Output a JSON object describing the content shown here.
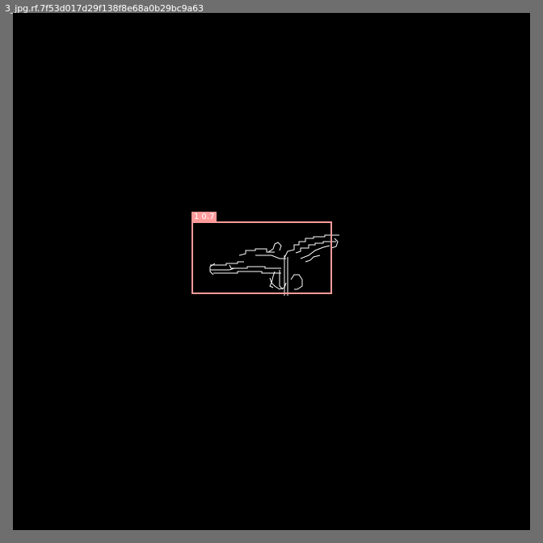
{
  "window": {
    "filename": "3_jpg.rf.7f53d017d29f138f8e68a0b29bc9a63"
  },
  "detection": {
    "label": "1 0.7",
    "box_color": "#ff9b9b"
  },
  "colors": {
    "outer_background": "#6e6e6e",
    "canvas_background": "#000000",
    "edge_lines": "#ffffff"
  }
}
